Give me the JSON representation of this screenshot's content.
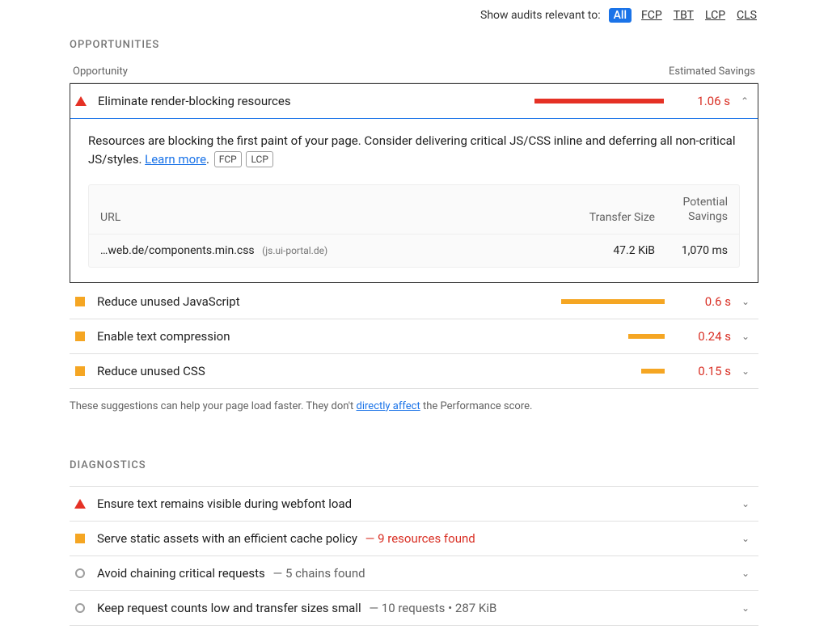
{
  "filter": {
    "label": "Show audits relevant to:",
    "options": [
      "All",
      "FCP",
      "TBT",
      "LCP",
      "CLS"
    ],
    "active": "All"
  },
  "opportunities": {
    "title": "OPPORTUNITIES",
    "col_opportunity": "Opportunity",
    "col_savings": "Estimated Savings",
    "footnote_pre": "These suggestions can help your page load faster. They don't ",
    "footnote_link": "directly affect",
    "footnote_post": " the Performance score.",
    "items": [
      {
        "severity": "fail",
        "label": "Eliminate render-blocking resources",
        "bar_pct": 100,
        "bar_color": "red",
        "time": "1.06 s",
        "expanded": true,
        "desc_pre": "Resources are blocking the first paint of your page. Consider delivering critical JS/CSS inline and deferring all non-critical JS/styles. ",
        "desc_link": "Learn more",
        "tags": [
          "FCP",
          "LCP"
        ],
        "table": {
          "col_url": "URL",
          "col_size": "Transfer Size",
          "col_save": "Potential Savings",
          "rows": [
            {
              "url": "…web.de/components.min.css",
              "host": "(js.ui-portal.de)",
              "size": "47.2 KiB",
              "savings": "1,070 ms"
            }
          ]
        }
      },
      {
        "severity": "avg",
        "label": "Reduce unused JavaScript",
        "bar_pct": 80,
        "bar_color": "orange",
        "time": "0.6 s",
        "expanded": false
      },
      {
        "severity": "avg",
        "label": "Enable text compression",
        "bar_pct": 28,
        "bar_color": "orange",
        "time": "0.24 s",
        "expanded": false
      },
      {
        "severity": "avg",
        "label": "Reduce unused CSS",
        "bar_pct": 18,
        "bar_color": "orange",
        "time": "0.15 s",
        "expanded": false
      }
    ]
  },
  "diagnostics": {
    "title": "DIAGNOSTICS",
    "items": [
      {
        "severity": "fail",
        "label": "Ensure text remains visible during webfont load",
        "inline": "",
        "inline_style": ""
      },
      {
        "severity": "avg",
        "label": "Serve static assets with an efficient cache policy",
        "inline": "— 9 resources found",
        "inline_style": "red"
      },
      {
        "severity": "pass",
        "label": "Avoid chaining critical requests",
        "inline": "— 5 chains found",
        "inline_style": "gray"
      },
      {
        "severity": "pass",
        "label": "Keep request counts low and transfer sizes small",
        "inline": "— 10 requests • 287 KiB",
        "inline_style": "gray"
      }
    ]
  }
}
